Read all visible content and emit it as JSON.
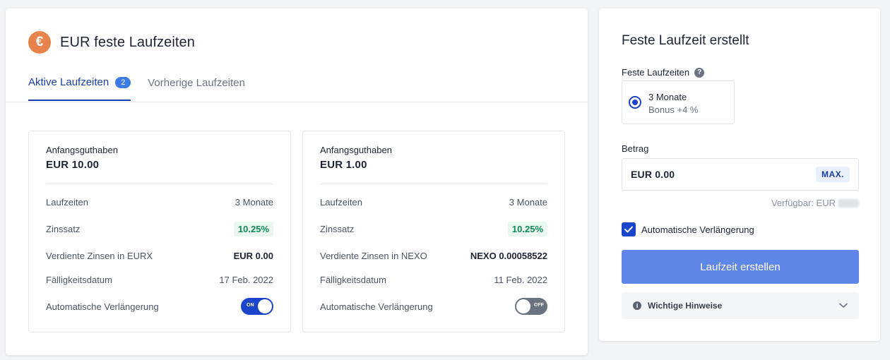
{
  "header": {
    "currency_symbol": "€",
    "title": "EUR feste Laufzeiten"
  },
  "tabs": [
    {
      "label": "Aktive Laufzeiten",
      "badge": "2",
      "active": true
    },
    {
      "label": "Vorherige Laufzeiten",
      "active": false
    }
  ],
  "cards": [
    {
      "initial_label": "Anfangsguthaben",
      "initial_amount": "EUR 10.00",
      "rows": {
        "term_label": "Laufzeiten",
        "term_value": "3 Monate",
        "rate_label": "Zinssatz",
        "rate_value": "10.25%",
        "earned_label": "Verdiente Zinsen in EURX",
        "earned_value": "EUR 0.00",
        "due_label": "Fälligkeitsdatum",
        "due_value": "17 Feb. 2022",
        "renew_label": "Automatische Verlängerung"
      },
      "toggle": {
        "state": "ON"
      }
    },
    {
      "initial_label": "Anfangsguthaben",
      "initial_amount": "EUR 1.00",
      "rows": {
        "term_label": "Laufzeiten",
        "term_value": "3 Monate",
        "rate_label": "Zinssatz",
        "rate_value": "10.25%",
        "earned_label": "Verdiente Zinsen in NEXO",
        "earned_value": "NEXO 0.00058522",
        "due_label": "Fälligkeitsdatum",
        "due_value": "11 Feb. 2022",
        "renew_label": "Automatische Verlängerung"
      },
      "toggle": {
        "state": "OFF"
      }
    }
  ],
  "create": {
    "title": "Feste Laufzeit erstellt",
    "terms_label": "Feste Laufzeiten",
    "help_icon": "?",
    "option": {
      "title": "3 Monate",
      "subtitle": "Bonus +4 %",
      "selected": true
    },
    "amount_label": "Betrag",
    "amount_value": "EUR 0.00",
    "max_label": "MAX.",
    "available_label": "Verfügbar: EUR",
    "auto_renew_label": "Automatische Verlängerung",
    "auto_renew_checked": true,
    "submit_label": "Laufzeit erstellen",
    "notes_label": "Wichtige Hinweise",
    "info_icon": "i"
  },
  "colors": {
    "accent": "#1a44c9",
    "tab_active": "#1a3fa8",
    "primary_button": "#5d86e6",
    "rate_green": "#0f8a58",
    "coin_orange": "#e9834e"
  }
}
